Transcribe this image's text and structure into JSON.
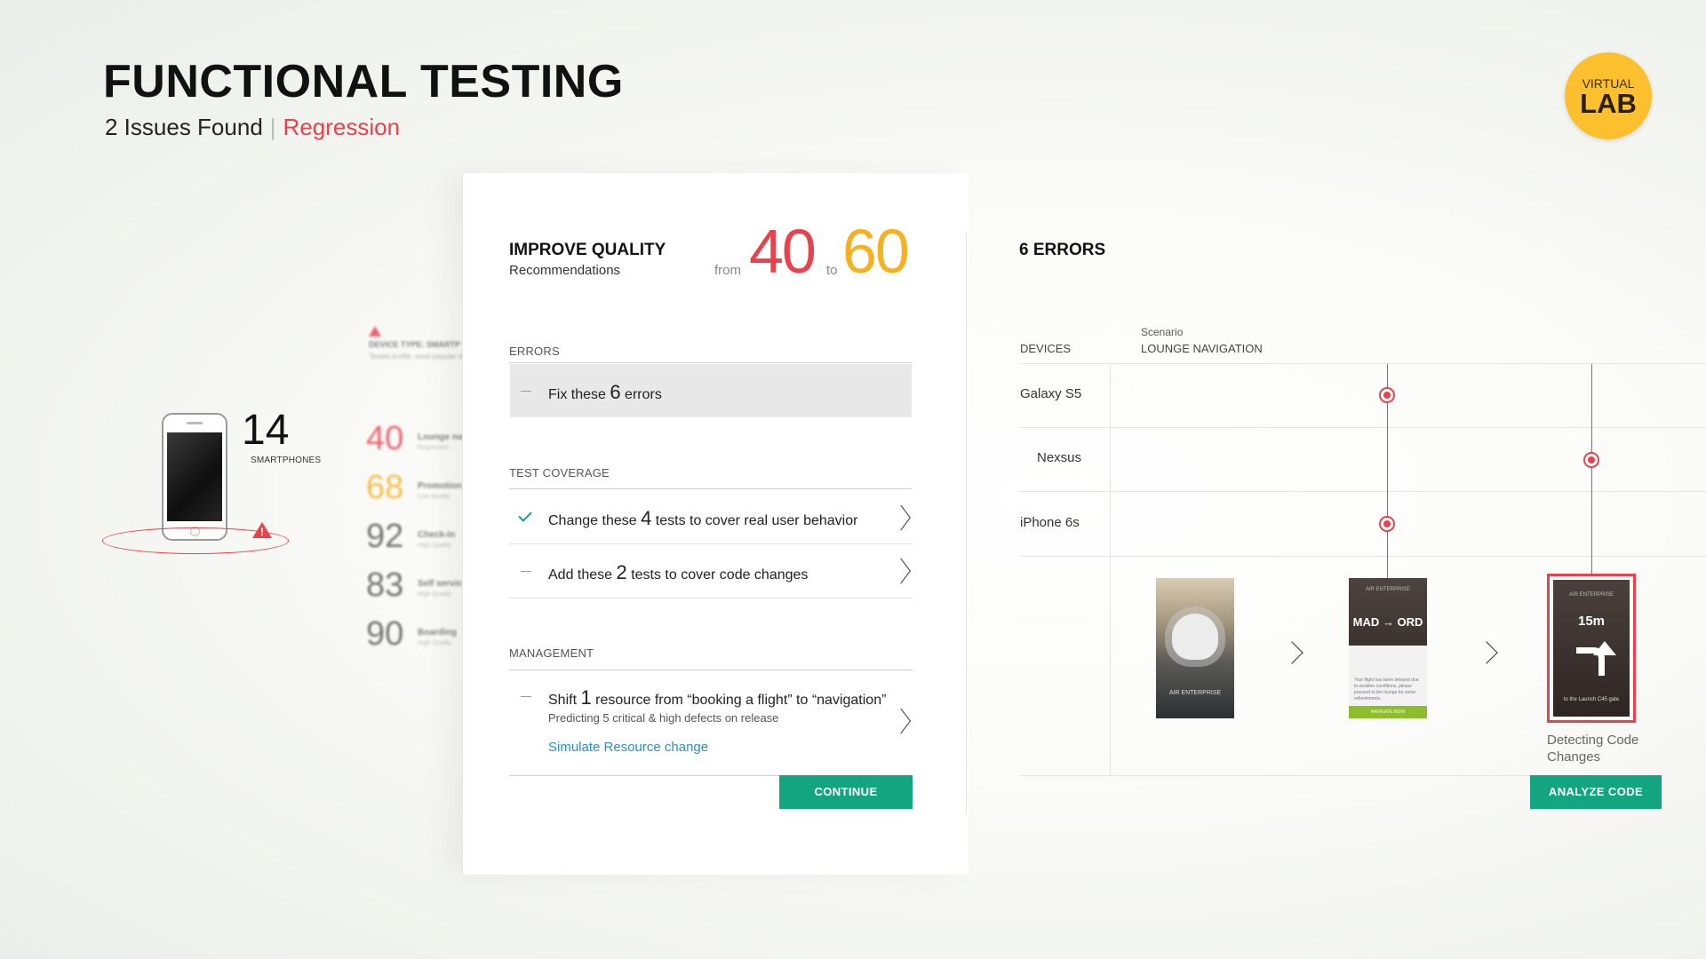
{
  "header": {
    "title": "FUNCTIONAL TESTING",
    "issues": "2 Issues Found",
    "separator": "|",
    "mode": "Regression"
  },
  "badge": {
    "top": "VIRTUAL",
    "big": "LAB"
  },
  "device_summary": {
    "count": "14",
    "label": "SMARTPHONES",
    "alert_glyph": "!"
  },
  "blurred_panel": {
    "heading": "DEVICE TYPE: SMARTP",
    "subheading": "Tested profile: most popular de",
    "rows": [
      {
        "score": "40",
        "label": "Lounge na",
        "sub": "Regression",
        "color": "#e8424c"
      },
      {
        "score": "68",
        "label": "Promotion",
        "sub": "Low Quality",
        "color": "#f5b120"
      },
      {
        "score": "92",
        "label": "Check-in",
        "sub": "High Quality",
        "color": "#555555"
      },
      {
        "score": "83",
        "label": "Self service",
        "sub": "High Quality",
        "color": "#555555"
      },
      {
        "score": "90",
        "label": "Boarding",
        "sub": "High Quality",
        "color": "#555555"
      }
    ]
  },
  "improve": {
    "title": "IMPROVE QUALITY",
    "subtitle": "Recommendations",
    "from_label": "from",
    "from_value": "40",
    "to_label": "to",
    "to_value": "60"
  },
  "errors_section": {
    "label": "ERRORS",
    "item": {
      "pre": "Fix these ",
      "num": "6",
      "post": " errors"
    }
  },
  "coverage_section": {
    "label": "TEST COVERAGE",
    "items": [
      {
        "pre": "Change these ",
        "num": "4",
        "post": " tests to cover real user behavior"
      },
      {
        "pre": "Add these ",
        "num": "2",
        "post": " tests to cover code changes"
      }
    ]
  },
  "management_section": {
    "label": "MANAGEMENT",
    "item": {
      "pre": "Shift ",
      "num": "1",
      "post": " resource from “booking a flight” to “navigation”",
      "note": "Predicting 5 critical & high defects on release",
      "link": "Simulate Resource change"
    }
  },
  "continue_label": "CONTINUE",
  "errors_panel": {
    "title": "6 ERRORS",
    "devices_label": "DEVICES",
    "scenario_label": "Scenario",
    "scenario_name": "LOUNGE NAVIGATION",
    "devices": [
      "Galaxy S5",
      "Nexsus",
      "iPhone 6s"
    ],
    "status_color": "#e8424c"
  },
  "screens": {
    "s1_label": "AIR ENTERPRISE",
    "s2_header": "AIR ENTERPRISE",
    "s2_route": "MAD → ORD",
    "s2_text": "Your flight has been delayed due to weather conditions, please proceed to the lounge for some refreshments.",
    "s2_button": "NAVIGATE NOW",
    "s3_header": "AIR ENTERPRISE",
    "s3_minutes": "15m",
    "s3_to": "to the Launch C45 gate",
    "caption": "Detecting Code Changes"
  },
  "analyze_label": "ANALYZE CODE",
  "colors": {
    "accent_red": "#e8424c",
    "accent_yellow": "#f5b120",
    "accent_green": "#12a57f",
    "badge": "#fcc02f",
    "link": "#2a8fc4"
  }
}
